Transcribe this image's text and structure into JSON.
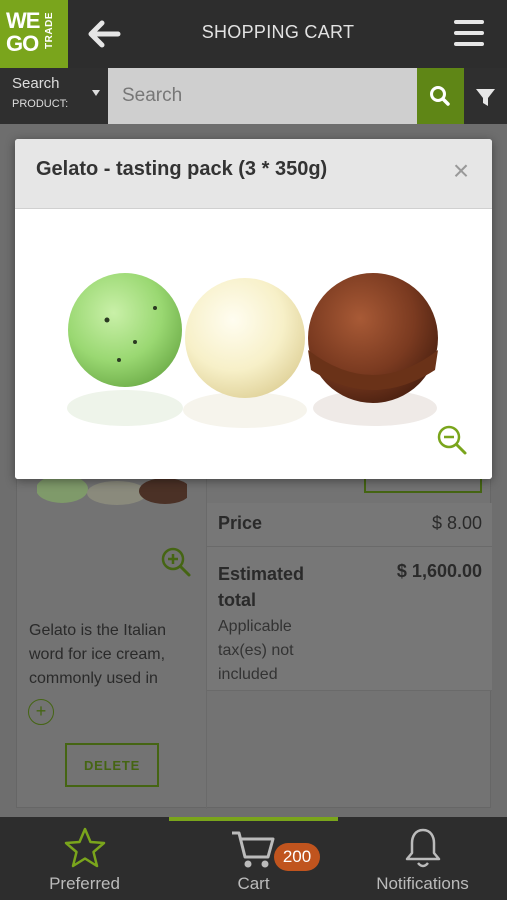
{
  "header": {
    "logo_line1": "WE",
    "logo_line2": "GO",
    "logo_side": "TRADE",
    "title": "SHOPPING CART",
    "colors": {
      "brand": "#7aa51c",
      "bar": "#2d2d2d"
    }
  },
  "search": {
    "type_label": "Search",
    "type_value": "PRODUCT:",
    "placeholder": "Search"
  },
  "modal": {
    "title": "Gelato - tasting pack (3 * 350g)",
    "close_symbol": "×"
  },
  "cart_item": {
    "description": "Gelato is the Italian word for ice cream, commonly used in",
    "expand_symbol": "+",
    "delete_label": "DELETE",
    "price_label": "Price",
    "price_value": "$ 8.00",
    "total_label": "Estimated total",
    "total_value": "$ 1,600.00",
    "total_note": "Applicable tax(es) not included"
  },
  "bottom_nav": {
    "preferred": "Preferred",
    "cart": "Cart",
    "cart_badge": "200",
    "notifications": "Notifications",
    "badge_color": "#c0541e"
  }
}
